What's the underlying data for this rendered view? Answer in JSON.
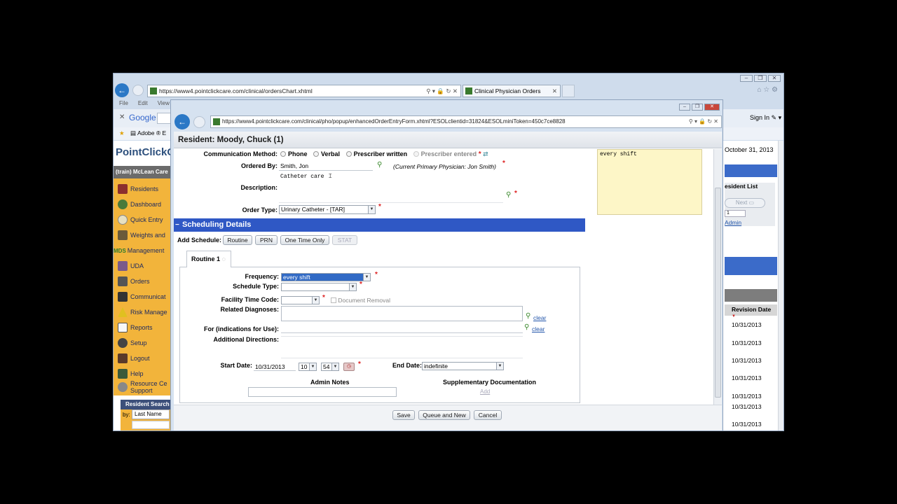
{
  "back_window": {
    "url": "https://www4.pointclickcare.com/clinical/ordersChart.xhtml",
    "tab_title": "Clinical Physician Orders",
    "menu": [
      "File",
      "Edit",
      "View"
    ],
    "toolbar_google": "Google",
    "favbar_item": "Adobe ® E",
    "sign_in": "Sign In",
    "logo": "PointClickC",
    "facility": "(train) McLean Care",
    "sidebar_items": [
      "Residents",
      "Dashboard",
      "Quick Entry",
      "Weights and",
      "Management",
      "UDA",
      "Orders",
      "Communicat",
      "Risk Manage",
      "Reports",
      "Setup",
      "Logout",
      "Help",
      "Resource Ce"
    ],
    "sidebar_item_support": "Support",
    "mds_label": "MDS",
    "resident_search": "Resident Search",
    "search_by": "by:",
    "search_field": "Last Name",
    "right_date": "October 31, 2013",
    "resident_list": "esident List",
    "next_label": "Next",
    "page_value": "1",
    "admin_link": "Admin",
    "revision_date": "Revision Date",
    "revision_dates": [
      "10/31/2013",
      "10/31/2013",
      "10/31/2013",
      "10/31/2013",
      "10/31/2013",
      "10/31/2013",
      "10/31/2013"
    ]
  },
  "popup": {
    "url": "https://www4.pointclickcare.com/clinical/pho/popup/enhancedOrderEntryForm.xhtml?ESOLclientid=31824&ESOLminiToken=450c7ce8828",
    "header": "Resident: Moody, Chuck (1)",
    "communication_method_label": "Communication Method:",
    "comm_options": [
      "Phone",
      "Verbal",
      "Prescriber written",
      "Prescriber entered"
    ],
    "ordered_by_label": "Ordered By:",
    "ordered_by_value": "Smith, Jon",
    "current_physician": "(Current Primary Physician:  Jon Smith)",
    "description_label": "Description:",
    "description_value": "Catheter care",
    "order_type_label": "Order Type:",
    "order_type_value": "Urinary Catheter - [TAR]",
    "note_text": "every shift",
    "scheduling_title": "Scheduling Details",
    "add_schedule_label": "Add Schedule:",
    "schedule_buttons": [
      "Routine",
      "PRN",
      "One Time Only",
      "STAT"
    ],
    "tab_label": "Routine",
    "tab_number": "1",
    "frequency_label": "Frequency:",
    "frequency_value": "every shift",
    "schedule_type_label": "Schedule Type:",
    "facility_time_code_label": "Facility Time Code:",
    "document_removal": "Document Removal",
    "related_diagnoses_label": "Related Diagnoses:",
    "indications_label": "For (indications for Use):",
    "additional_directions_label": "Additional Directions:",
    "clear_label": "clear",
    "start_date_label": "Start Date:",
    "start_date_value": "10/31/2013",
    "start_hour": "10",
    "start_minute": "54",
    "end_date_label": "End Date:",
    "end_date_value": "indefinite",
    "admin_notes_label": "Admin Notes",
    "supplementary_label": "Supplementary Documentation",
    "add_label": "Add",
    "save_label": "Save",
    "queue_label": "Queue and New",
    "cancel_label": "Cancel"
  }
}
